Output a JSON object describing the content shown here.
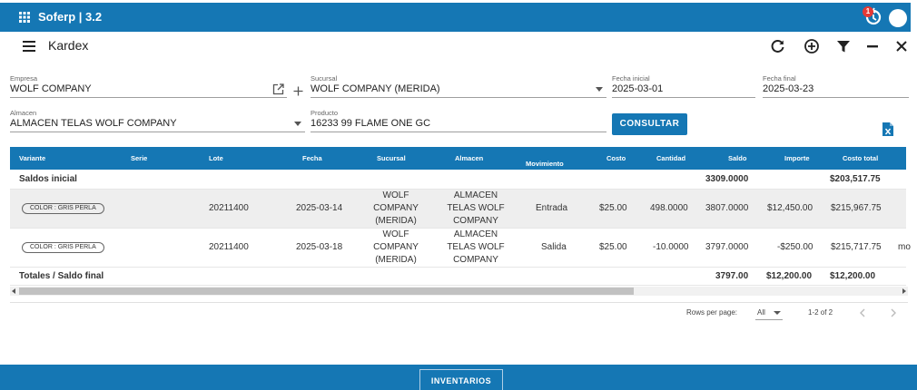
{
  "app": {
    "title": "Soferp | 3.2",
    "notification_count": "1",
    "colors": {
      "primary": "#1577b4",
      "badge": "#e53935",
      "row_highlight": "#eeeeee"
    },
    "icons": [
      "apps-grid-icon",
      "sync-icon",
      "avatar"
    ]
  },
  "toolbar": {
    "title": "Kardex",
    "actions": [
      "refresh-icon",
      "add-circle-icon",
      "filter-icon",
      "minimize-icon",
      "close-icon"
    ]
  },
  "filters": {
    "empresa": {
      "label": "Empresa",
      "value": "WOLF COMPANY"
    },
    "sucursal": {
      "label": "Sucursal",
      "value": "WOLF COMPANY (MERIDA)"
    },
    "fecha_inicial": {
      "label": "Fecha inicial",
      "value": "2025-03-01"
    },
    "fecha_final": {
      "label": "Fecha final",
      "value": "2025-03-23"
    },
    "almacen": {
      "label": "Almacen",
      "value": "ALMACEN TELAS WOLF COMPANY"
    },
    "producto": {
      "label": "Producto",
      "value": "16233 99 FLAME ONE GC"
    },
    "consultar_label": "CONSULTAR"
  },
  "table": {
    "columns": {
      "variante": "Variante",
      "serie": "Serie",
      "lote": "Lote",
      "fecha": "Fecha",
      "sucursal": "Sucursal",
      "almacen": "Almacen",
      "movimiento": "Movimiento",
      "costo": "Costo",
      "cantidad": "Cantidad",
      "saldo": "Saldo",
      "importe": "Importe",
      "costo_total": "Costo total"
    },
    "saldos_inicial": {
      "label": "Saldos inicial",
      "saldo": "3309.0000",
      "costo_total": "$203,517.75"
    },
    "rows": [
      {
        "variante": "COLOR : GRIS PERLA",
        "lote": "20211400",
        "fecha": "2025-03-14",
        "sucursal": [
          "WOLF",
          "COMPANY",
          "(MERIDA)"
        ],
        "almacen": [
          "ALMACEN",
          "TELAS WOLF",
          "COMPANY"
        ],
        "movimiento": "Entrada",
        "costo": "$25.00",
        "cantidad": "498.0000",
        "saldo": "3807.0000",
        "importe": "$12,450.00",
        "costo_total": "$215,967.75",
        "extra": ""
      },
      {
        "variante": "COLOR : GRIS PERLA",
        "lote": "20211400",
        "fecha": "2025-03-18",
        "sucursal": [
          "WOLF",
          "COMPANY",
          "(MERIDA)"
        ],
        "almacen": [
          "ALMACEN",
          "TELAS WOLF",
          "COMPANY"
        ],
        "movimiento": "Salida",
        "costo": "$25.00",
        "cantidad": "-10.0000",
        "saldo": "3797.0000",
        "importe": "-$250.00",
        "costo_total": "$215,717.75",
        "extra": "mo"
      }
    ],
    "totales": {
      "label": "Totales / Saldo final",
      "saldo": "3797.00",
      "importe": "$12,200.00",
      "costo_total": "$12,200.00"
    }
  },
  "pagination": {
    "rows_per_page_label": "Rows per page:",
    "rows_per_page_value": "All",
    "range": "1-2 of 2"
  },
  "footer": {
    "tab_label": "INVENTARIOS"
  }
}
